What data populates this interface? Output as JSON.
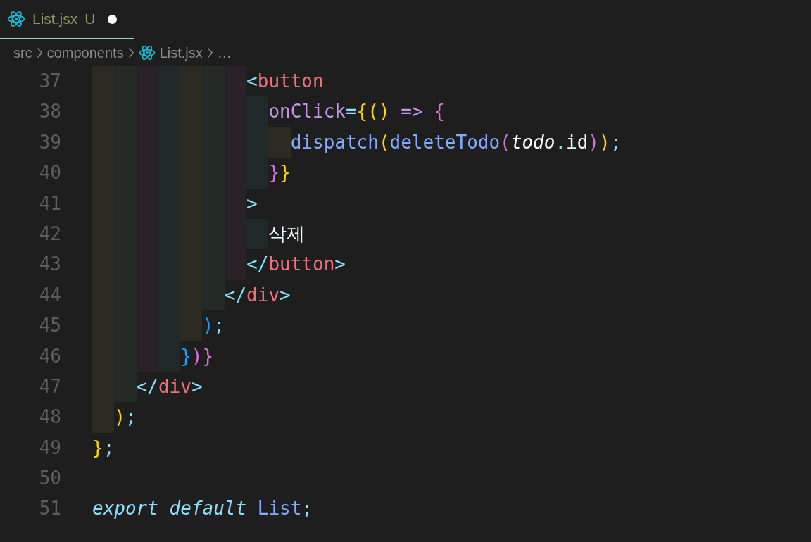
{
  "tab": {
    "label": "List.jsx",
    "status": "U",
    "modified": true,
    "selected": true
  },
  "breadcrumbs": [
    {
      "kind": "folder",
      "label": "src"
    },
    {
      "kind": "folder",
      "label": "components"
    },
    {
      "kind": "file",
      "label": "List.jsx"
    },
    {
      "kind": "more",
      "label": "…"
    }
  ],
  "lines": [
    {
      "number": "37",
      "guides": [
        {
          "color": "#2c2b22"
        },
        {
          "color": "#242a25"
        },
        {
          "color": "#2b2129"
        },
        {
          "color": "#212a2a"
        },
        {
          "color": "#2c2b22"
        },
        {
          "color": "#242a25"
        },
        {
          "color": "#2b2129"
        }
      ],
      "tokens": [
        {
          "kind": "punct",
          "text": "<"
        },
        {
          "kind": "tag",
          "text": "button"
        }
      ]
    },
    {
      "number": "38",
      "guides": [
        {
          "color": "#2c2b22"
        },
        {
          "color": "#242a25"
        },
        {
          "color": "#2b2129"
        },
        {
          "color": "#212a2a"
        },
        {
          "color": "#2c2b22"
        },
        {
          "color": "#242a25"
        },
        {
          "color": "#2b2129"
        },
        {
          "color": "#212a2a"
        }
      ],
      "tokens": [
        {
          "kind": "attr",
          "text": "onClick"
        },
        {
          "kind": "punct",
          "text": "="
        },
        {
          "kind": "b1",
          "text": "{("
        },
        {
          "kind": "b1",
          "text": ")"
        },
        {
          "kind": "attr",
          "text": " =>"
        },
        {
          "kind": "b2",
          "text": " {"
        }
      ]
    },
    {
      "number": "39",
      "guides": [
        {
          "color": "#2c2b22"
        },
        {
          "color": "#242a25"
        },
        {
          "color": "#2b2129"
        },
        {
          "color": "#212a2a"
        },
        {
          "color": "#2c2b22"
        },
        {
          "color": "#242a25"
        },
        {
          "color": "#2b2129"
        },
        {
          "color": "#212a2a"
        },
        {
          "color": "#2c2b22"
        }
      ],
      "tokens": [
        {
          "kind": "func",
          "text": "dispatch"
        },
        {
          "kind": "b1",
          "text": "("
        },
        {
          "kind": "func",
          "text": "deleteTodo"
        },
        {
          "kind": "b2",
          "text": "("
        },
        {
          "kind": "param",
          "text": "todo"
        },
        {
          "kind": "punct",
          "text": "."
        },
        {
          "kind": "plain",
          "text": "id"
        },
        {
          "kind": "b2",
          "text": ")"
        },
        {
          "kind": "b1",
          "text": ")"
        },
        {
          "kind": "punct",
          "text": ";"
        }
      ]
    },
    {
      "number": "40",
      "guides": [
        {
          "color": "#2c2b22"
        },
        {
          "color": "#242a25"
        },
        {
          "color": "#2b2129"
        },
        {
          "color": "#212a2a"
        },
        {
          "color": "#2c2b22"
        },
        {
          "color": "#242a25"
        },
        {
          "color": "#2b2129"
        },
        {
          "color": "#212a2a"
        }
      ],
      "tokens": [
        {
          "kind": "b2",
          "text": "}"
        },
        {
          "kind": "b1",
          "text": "}"
        }
      ]
    },
    {
      "number": "41",
      "guides": [
        {
          "color": "#2c2b22"
        },
        {
          "color": "#242a25"
        },
        {
          "color": "#2b2129"
        },
        {
          "color": "#212a2a"
        },
        {
          "color": "#2c2b22"
        },
        {
          "color": "#242a25"
        },
        {
          "color": "#2b2129"
        }
      ],
      "tokens": [
        {
          "kind": "punct",
          "text": ">"
        }
      ]
    },
    {
      "number": "42",
      "guides": [
        {
          "color": "#2c2b22"
        },
        {
          "color": "#242a25"
        },
        {
          "color": "#2b2129"
        },
        {
          "color": "#212a2a"
        },
        {
          "color": "#2c2b22"
        },
        {
          "color": "#242a25"
        },
        {
          "color": "#2b2129"
        },
        {
          "color": "#212a2a"
        }
      ],
      "tokens": [
        {
          "kind": "plain",
          "text": "삭제"
        }
      ]
    },
    {
      "number": "43",
      "guides": [
        {
          "color": "#2c2b22"
        },
        {
          "color": "#242a25"
        },
        {
          "color": "#2b2129"
        },
        {
          "color": "#212a2a"
        },
        {
          "color": "#2c2b22"
        },
        {
          "color": "#242a25"
        },
        {
          "color": "#2b2129"
        }
      ],
      "tokens": [
        {
          "kind": "punct",
          "text": "</"
        },
        {
          "kind": "tag",
          "text": "button"
        },
        {
          "kind": "punct",
          "text": ">"
        }
      ]
    },
    {
      "number": "44",
      "guides": [
        {
          "color": "#2c2b22"
        },
        {
          "color": "#242a25"
        },
        {
          "color": "#2b2129"
        },
        {
          "color": "#212a2a"
        },
        {
          "color": "#2c2b22"
        },
        {
          "color": "#242a25"
        }
      ],
      "tokens": [
        {
          "kind": "punct",
          "text": "</"
        },
        {
          "kind": "tag",
          "text": "div"
        },
        {
          "kind": "punct",
          "text": ">"
        }
      ]
    },
    {
      "number": "45",
      "guides": [
        {
          "color": "#2c2b22"
        },
        {
          "color": "#242a25"
        },
        {
          "color": "#2b2129"
        },
        {
          "color": "#212a2a"
        },
        {
          "color": "#2c2b22"
        }
      ],
      "tokens": [
        {
          "kind": "b3",
          "text": ")"
        },
        {
          "kind": "punct",
          "text": ";"
        }
      ]
    },
    {
      "number": "46",
      "guides": [
        {
          "color": "#2c2b22"
        },
        {
          "color": "#242a25"
        },
        {
          "color": "#2b2129"
        },
        {
          "color": "#212a2a"
        }
      ],
      "tokens": [
        {
          "kind": "b3",
          "text": "}"
        },
        {
          "kind": "b2",
          "text": ")}"
        }
      ]
    },
    {
      "number": "47",
      "guides": [
        {
          "color": "#2c2b22"
        },
        {
          "color": "#242a25"
        }
      ],
      "tokens": [
        {
          "kind": "punct",
          "text": "</"
        },
        {
          "kind": "tag",
          "text": "div"
        },
        {
          "kind": "punct",
          "text": ">"
        }
      ]
    },
    {
      "number": "48",
      "guides": [
        {
          "color": "#2c2b22"
        }
      ],
      "tokens": [
        {
          "kind": "b1",
          "text": ")"
        },
        {
          "kind": "punct",
          "text": ";"
        }
      ]
    },
    {
      "number": "49",
      "tokens": [
        {
          "kind": "b1",
          "text": "}"
        },
        {
          "kind": "punct",
          "text": ";"
        }
      ]
    },
    {
      "number": "50"
    },
    {
      "number": "51",
      "tokens": [
        {
          "kind": "keyword",
          "text": "export default"
        },
        {
          "kind": "func",
          "text": " List"
        },
        {
          "kind": "punct",
          "text": ";"
        }
      ]
    }
  ]
}
